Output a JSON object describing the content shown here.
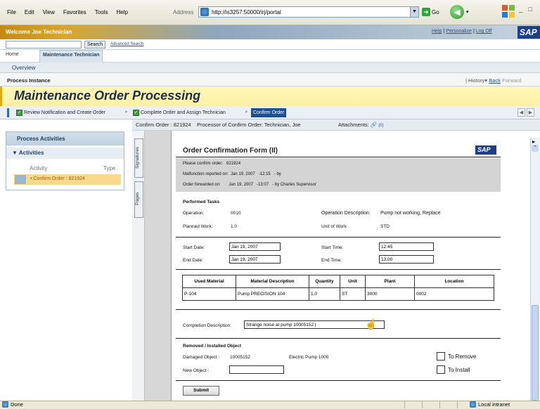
{
  "browser": {
    "menus": [
      "File",
      "Edit",
      "View",
      "Favorites",
      "Tools",
      "Help"
    ],
    "address_label": "Address",
    "address_url": "http://is3257:50000/irj/portal",
    "go_label": "Go",
    "window_controls": "_ □"
  },
  "portal": {
    "welcome": "Welcome Joe Technician",
    "links": [
      "Help",
      "Personalize",
      "Log Off"
    ],
    "link_sep": "|",
    "logo": "SAP",
    "search_button": "Search",
    "advanced_search": "Advanced Search",
    "top_tabs": [
      "Home",
      "Maintenance Technician"
    ],
    "overview": "Overview",
    "process_instance": "Process Instance",
    "history": [
      "History",
      "Back",
      "Forward"
    ]
  },
  "title": "Maintenance Order Processing",
  "steps": [
    "Review Notification and Create Order",
    "Complete Order and Assign Technician",
    "Confirm Order"
  ],
  "step_nav": [
    "◀",
    "▶"
  ],
  "left": {
    "panel_title": "Process Activities",
    "activities_title": "Activities",
    "col_activity": "Activity",
    "col_type": "Type",
    "activity_item": "Confirm Order : 821924"
  },
  "content_header": {
    "text": "Confirm Order : 821924    Processor of Confirm Order: Technician, Joe",
    "attachments": "Attachments:",
    "attach_count": "(0)"
  },
  "side_tabs": [
    "Signatures",
    "Pages"
  ],
  "form": {
    "title": "Order Confirmation Form (II)",
    "logo": "SAP",
    "grey": {
      "l1_label": "Please confirm order:",
      "l1_value": "821924",
      "l2_label": "Malfunction reported on:",
      "l2_value": "Jan 19, 2007   -12:15   - by",
      "l3_label": "Order forwarded on:",
      "l3_value": "Jan 19, 2007   -13:07   - by Charles Supervisor"
    },
    "performed_tasks": "Performed Tasks",
    "operation_label": "Operation:",
    "operation_value": "0010",
    "op_desc_label": "Operation Description:",
    "op_desc_value": "Pump not working, Replace",
    "planned_label": "Planned Work:",
    "planned_value": "1.0",
    "unit_work_label": "Unit of Work:",
    "unit_work_value": "STD",
    "start_date_label": "Start Date:",
    "start_date_value": "Jan 19, 2007",
    "start_time_label": "Start Time:",
    "start_time_value": "12:45",
    "end_date_label": "End Date:",
    "end_date_value": "Jan 19, 2007",
    "end_time_label": "End Time:",
    "end_time_value": "13:00",
    "table_headers": [
      "Used Material",
      "Material Description",
      "Quantity",
      "Unit",
      "Plant",
      "Location"
    ],
    "table_row": [
      "P-104",
      "Pump PRECISION 104",
      "1.0",
      "ST",
      "3000",
      "0002"
    ],
    "completion_label": "Completion Description:",
    "completion_value": "Strange noise at pump 10005152 |",
    "removed_title": "Removed / Installed Object",
    "damaged_label": "Damaged Object :",
    "damaged_value": "10005152",
    "damaged_desc": "Electric Pump 1000",
    "new_object_label": "New Object :",
    "to_remove": "To Remove",
    "to_install": "To Install",
    "submit": "Submit"
  },
  "status": {
    "done": "Done",
    "zone": "Local intranet"
  }
}
